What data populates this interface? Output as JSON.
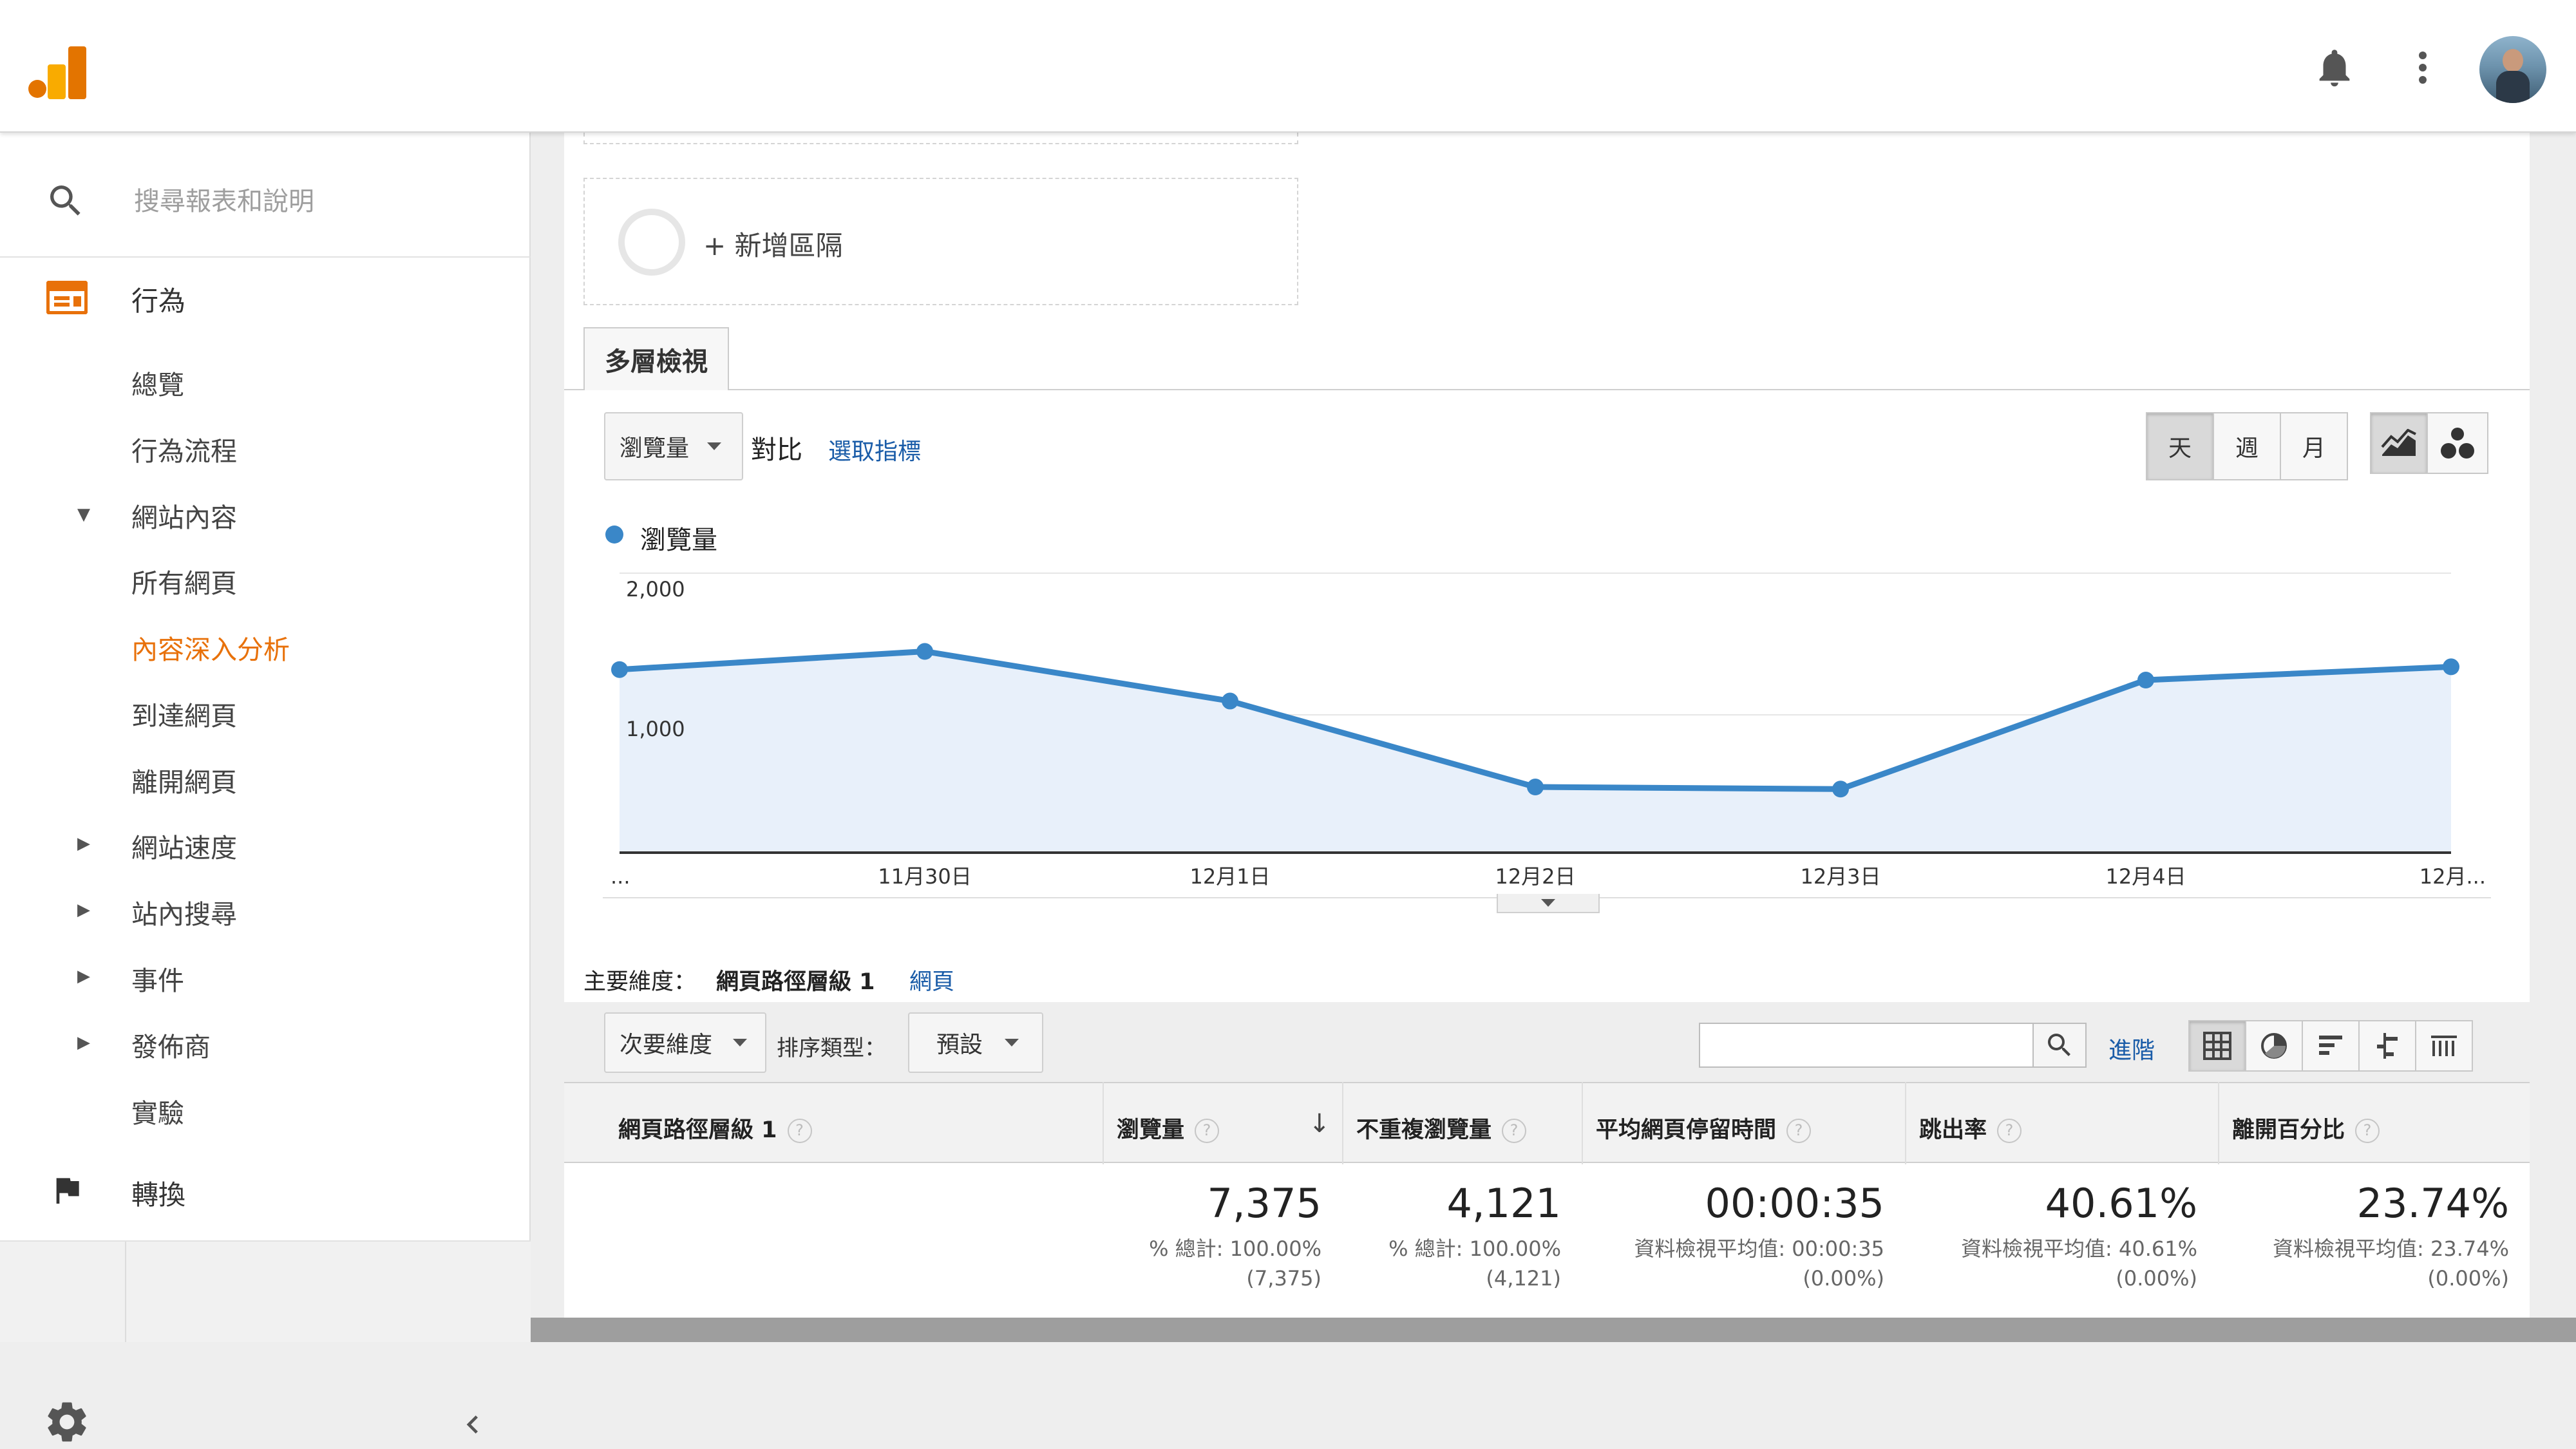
{
  "sidebar": {
    "search_placeholder": "搜尋報表和說明",
    "section": "行為",
    "items": [
      {
        "label": "總覽"
      },
      {
        "label": "行為流程"
      },
      {
        "label": "網站內容"
      },
      {
        "label": "所有網頁"
      },
      {
        "label": "內容深入分析"
      },
      {
        "label": "到達網頁"
      },
      {
        "label": "離開網頁"
      },
      {
        "label": "網站速度"
      },
      {
        "label": "站內搜尋"
      },
      {
        "label": "事件"
      },
      {
        "label": "發佈商"
      },
      {
        "label": "實驗"
      }
    ],
    "conversions": "轉換"
  },
  "segment": {
    "add_label": "+ 新增區隔"
  },
  "tabs": {
    "explorer": "多層檢視"
  },
  "controls": {
    "metric_select": "瀏覽量",
    "vs_label": "對比",
    "select_metric_link": "選取指標",
    "granularity": [
      "天",
      "週",
      "月"
    ],
    "granularity_selected": "天"
  },
  "chart_data": {
    "type": "area",
    "series": [
      {
        "name": "瀏覽量",
        "values": [
          1310,
          1440,
          1085,
          470,
          455,
          1235,
          1330
        ]
      }
    ],
    "x": [
      "...",
      "11月30日",
      "12月1日",
      "12月2日",
      "12月3日",
      "12月4日",
      "12月..."
    ],
    "yticks": [
      "2,000",
      "1,000"
    ],
    "ylim": [
      0,
      2000
    ],
    "color": "#3a87c8",
    "fill": "#e8f0fa",
    "grid": true,
    "legend_position": "top-left"
  },
  "dimension": {
    "label": "主要維度：",
    "selected": "網頁路徑層級 1",
    "alt_link": "網頁"
  },
  "table_controls": {
    "secondary_dimension": "次要維度",
    "sort_type_label": "排序類型：",
    "sort_value": "預設",
    "advanced_link": "進階"
  },
  "table": {
    "headers": [
      "網頁路徑層級 1",
      "瀏覽量",
      "不重複瀏覽量",
      "平均網頁停留時間",
      "跳出率",
      "離開百分比"
    ],
    "totals": [
      {
        "value": "7,375",
        "line1": "% 總計: 100.00%",
        "line2": "(7,375)"
      },
      {
        "value": "4,121",
        "line1": "% 總計: 100.00%",
        "line2": "(4,121)"
      },
      {
        "value": "00:00:35",
        "line1": "資料檢視平均值: 00:00:35",
        "line2": "(0.00%)"
      },
      {
        "value": "40.61%",
        "line1": "資料檢視平均值: 40.61%",
        "line2": "(0.00%)"
      },
      {
        "value": "23.74%",
        "line1": "資料檢視平均值: 23.74%",
        "line2": "(0.00%)"
      }
    ]
  },
  "colors": {
    "accent": "#e8710a",
    "link": "#1a5ca8",
    "series": "#3a87c8"
  }
}
